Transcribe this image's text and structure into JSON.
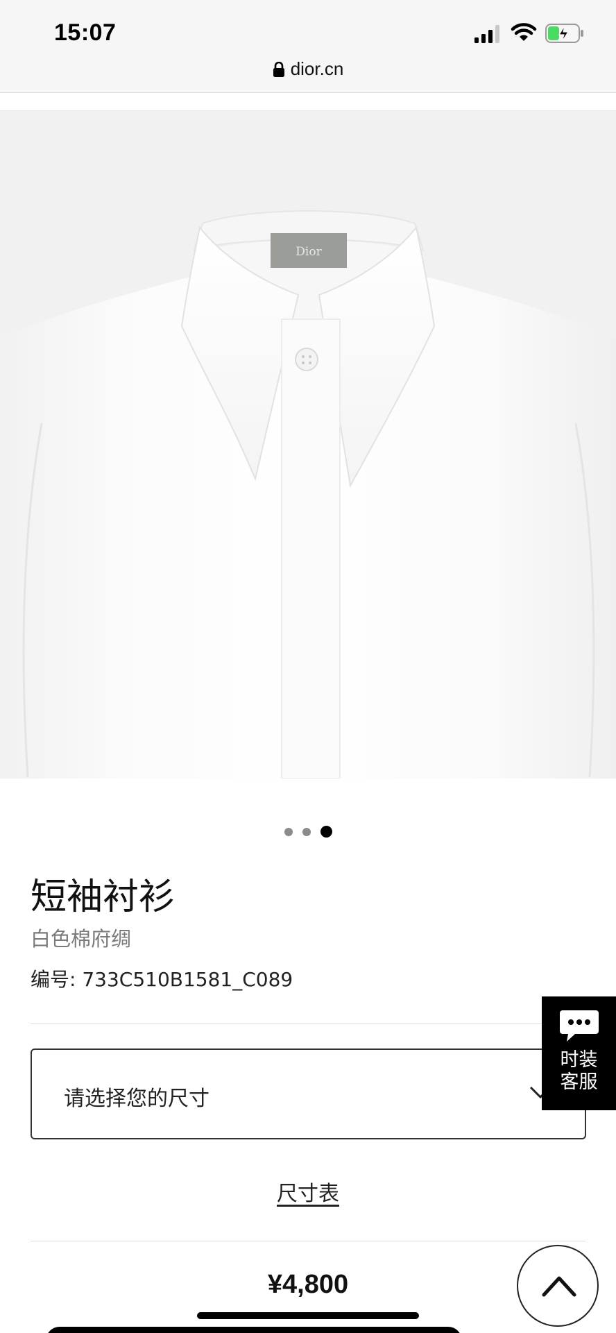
{
  "status_bar": {
    "time": "15:07",
    "url": "dior.cn",
    "icons": [
      "signal-icon",
      "wifi-icon",
      "battery-charging-icon",
      "lock-icon"
    ]
  },
  "product": {
    "image_label_text": "Dior",
    "carousel": {
      "total": 3,
      "active_index": 2
    },
    "title": "短袖衬衫",
    "subtitle": "白色棉府绸",
    "reference": "编号: 733C510B1581_C089",
    "size_select": {
      "placeholder": "请选择您的尺寸",
      "icon": "chevron-down-icon"
    },
    "size_chart_link": "尺寸表",
    "price": "¥4,800"
  },
  "chat_widget": {
    "icon": "chat-bubble-icon",
    "line1": "时装",
    "line2": "客服"
  },
  "scroll_top": {
    "icon": "chevron-up-icon"
  },
  "colors": {
    "accent": "#000000",
    "background": "#ffffff",
    "status_bar_bg": "#f6f6f6",
    "muted_text": "#7a7a7a",
    "battery_green": "#4cd964"
  }
}
